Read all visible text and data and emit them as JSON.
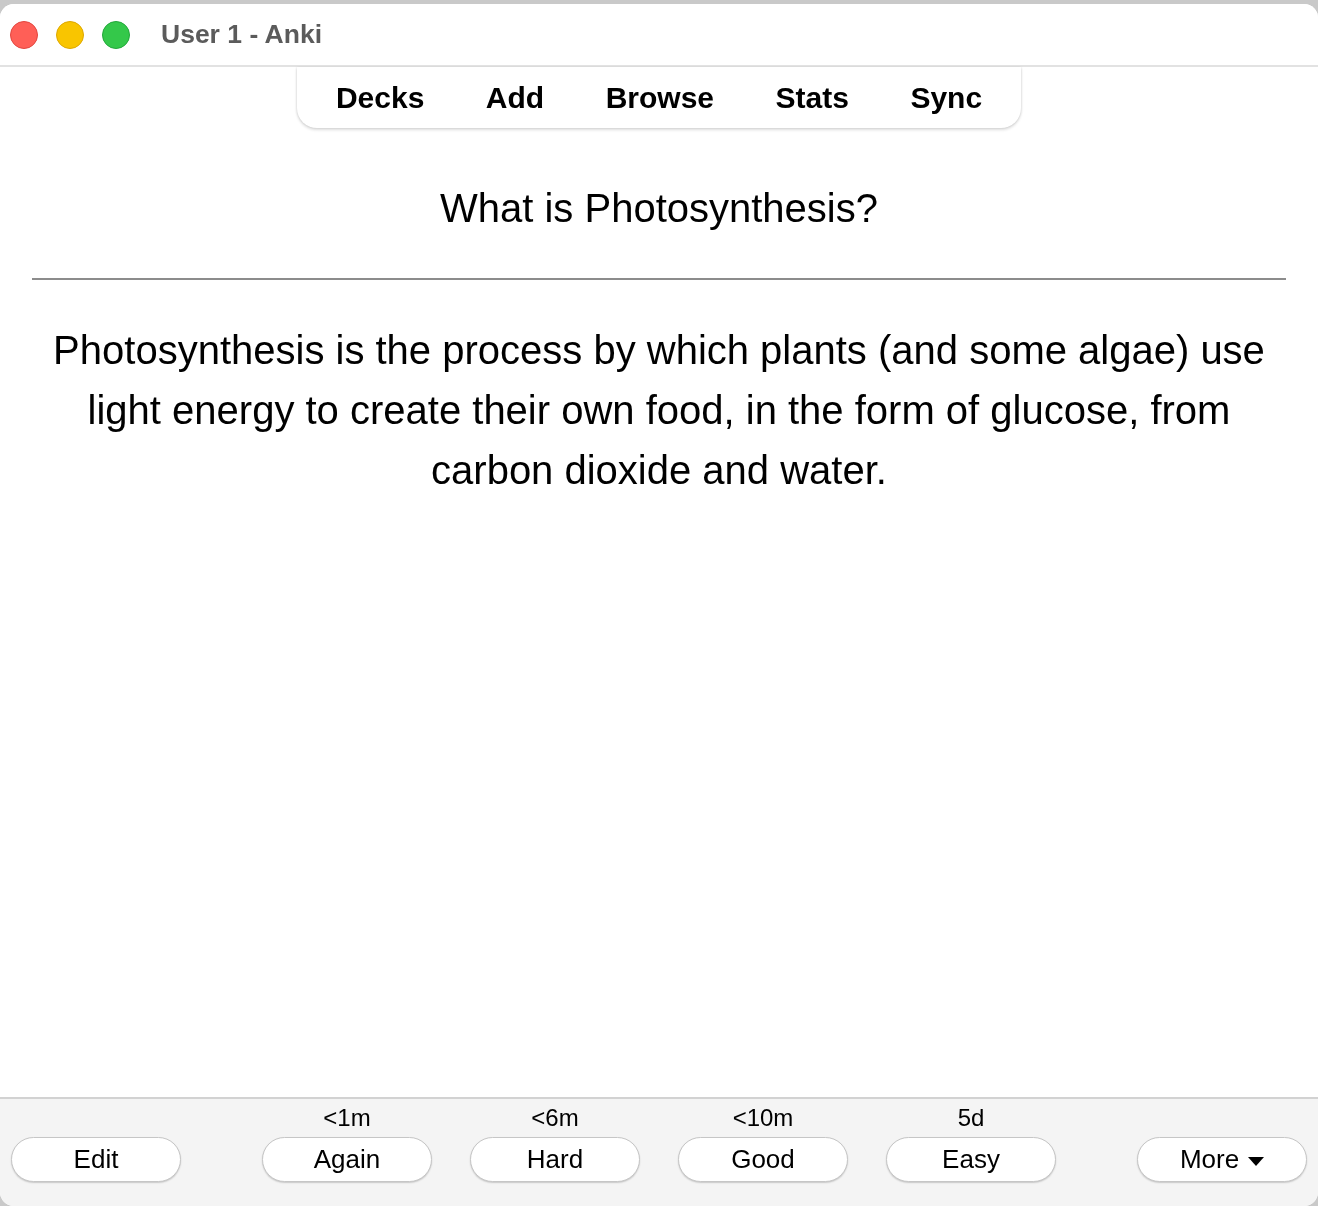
{
  "window": {
    "title": "User 1 - Anki"
  },
  "toolbar": {
    "items": [
      "Decks",
      "Add",
      "Browse",
      "Stats",
      "Sync"
    ]
  },
  "card": {
    "question": "What is Photosynthesis?",
    "answer": "Photosynthesis is the process by which plants (and some algae) use light energy to create their own food, in the form of glucose, from carbon dioxide and water."
  },
  "bottom_bar": {
    "edit_button": "Edit",
    "answer_buttons": [
      {
        "label": "Again",
        "interval": "<1m"
      },
      {
        "label": "Hard",
        "interval": "<6m"
      },
      {
        "label": "Good",
        "interval": "<10m"
      },
      {
        "label": "Easy",
        "interval": "5d"
      }
    ],
    "more_button": "More"
  }
}
